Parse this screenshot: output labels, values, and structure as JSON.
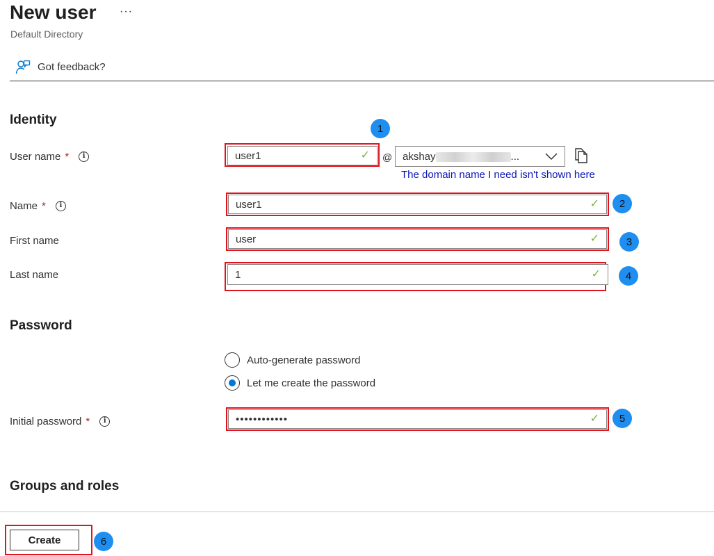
{
  "header": {
    "title": "New user",
    "more_label": "···",
    "subtitle": "Default Directory",
    "feedback_label": "Got feedback?"
  },
  "identity": {
    "section_title": "Identity",
    "username": {
      "label": "User name",
      "required_mark": "*",
      "value": "user1"
    },
    "at_sign": "@",
    "domain": {
      "value_visible": "akshay",
      "value_suffix": "..."
    },
    "domain_link": "The domain name I need isn't shown here",
    "name": {
      "label": "Name",
      "required_mark": "*",
      "value": "user1"
    },
    "first_name": {
      "label": "First name",
      "value": "user"
    },
    "last_name": {
      "label": "Last name",
      "value": "1"
    }
  },
  "password": {
    "section_title": "Password",
    "options": [
      {
        "label": "Auto-generate password",
        "selected": false
      },
      {
        "label": "Let me create the password",
        "selected": true
      }
    ],
    "initial_password": {
      "label": "Initial password",
      "required_mark": "*",
      "value": "••••••••••••"
    }
  },
  "groups": {
    "section_title": "Groups and roles"
  },
  "footer": {
    "create_label": "Create"
  },
  "steps": [
    "1",
    "2",
    "3",
    "4",
    "5",
    "6"
  ],
  "icons": {
    "info": "i",
    "check": "✓",
    "chevron": "chevron-down-icon",
    "copy": "copy-icon",
    "feedback": "feedback-person-icon"
  },
  "colors": {
    "highlight": "#e0141e",
    "step_badge": "#1f8ef1",
    "check": "#7cb342",
    "link": "#0b16b5",
    "radio_selected": "#0078d4"
  }
}
